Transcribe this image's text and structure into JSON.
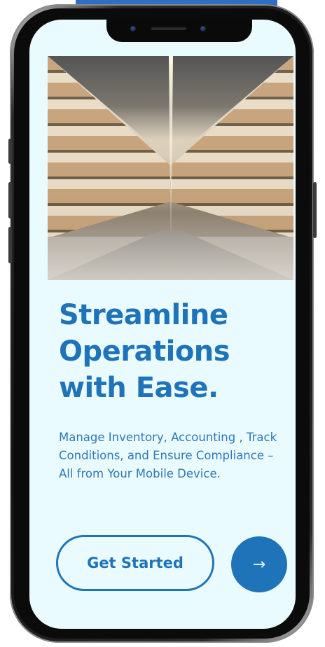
{
  "headline": {
    "line1": "Streamline",
    "line2": "Operations",
    "line3": "with Ease."
  },
  "subtext": "Manage Inventory, Accounting , Track Conditions, and Ensure Compliance – All from Your Mobile Device.",
  "buttons": {
    "get_started_label": "Get Started",
    "next_glyph": "→"
  },
  "icons": {
    "next": "arrow-right-icon"
  },
  "colors": {
    "accent": "#1f73b8",
    "screen_bg": "#eafbff",
    "frame": "#111111"
  }
}
